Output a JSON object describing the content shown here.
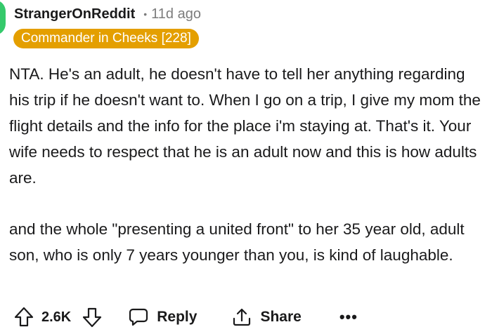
{
  "comment": {
    "author": "StrangerOnReddit",
    "separator": "•",
    "time_ago": "11d ago",
    "flair": "Commander in Cheeks [228]",
    "paragraphs": [
      "NTA. He's an adult, he doesn't have to tell her anything regarding his trip if he doesn't want to. When I go on a trip, I give my mom the flight details and the info for the place i'm staying at. That's it. Your wife needs to respect that he is an adult now and this is how adults are.",
      "and the whole \"presenting a united front\" to her 35 year old, adult son, who is only 7 years younger than you, is kind of laughable."
    ]
  },
  "actions": {
    "vote_count": "2.6K",
    "reply_label": "Reply",
    "share_label": "Share",
    "more_label": "•••"
  },
  "colors": {
    "flair_bg": "#e49f00",
    "avatar": "#35c96b",
    "muted_text": "#7c7c7c"
  },
  "icons": {
    "upvote": "arrow-up-outline",
    "downvote": "arrow-down-outline",
    "reply": "speech-bubble-outline",
    "share": "share-upload-outline",
    "more": "horizontal-ellipsis"
  }
}
